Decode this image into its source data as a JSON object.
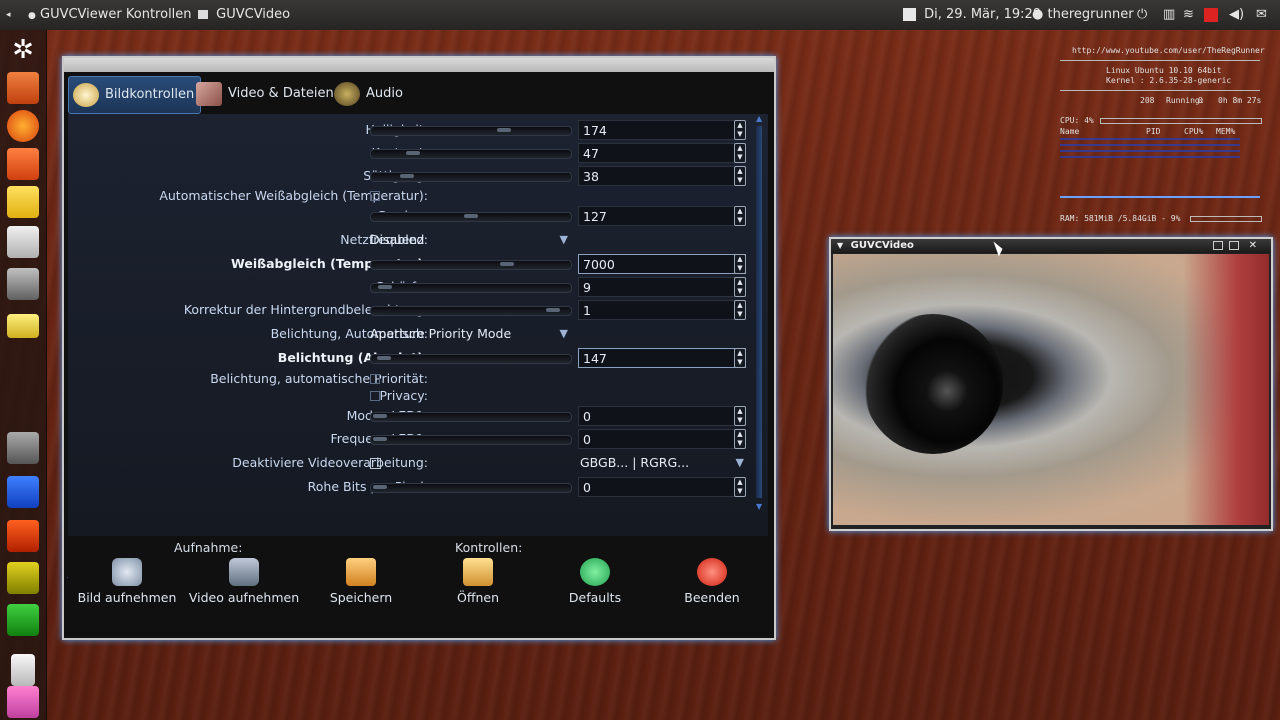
{
  "top_panel": {
    "app1": "GUVCViewer Kontrollen",
    "app2": "GUVCVideo",
    "clock": "Di, 29. Mär, 19:29",
    "user": "theregrunner"
  },
  "control_window": {
    "tabs": [
      {
        "label": "Bildkontrollen",
        "icon": "image-controls-icon"
      },
      {
        "label": "Video & Dateien",
        "icon": "video-files-icon"
      },
      {
        "label": "Audio",
        "icon": "audio-icon"
      }
    ],
    "controls": [
      {
        "label": "Helligkeit:",
        "type": "slider",
        "value": "174",
        "level": 0.68
      },
      {
        "label": "Kontrast:",
        "type": "slider",
        "value": "47",
        "level": 0.18
      },
      {
        "label": "Sättigung:",
        "type": "slider",
        "value": "38",
        "level": 0.15
      },
      {
        "label": "Automatischer Weißabgleich (Temperatur):",
        "type": "checkbox"
      },
      {
        "label": "Gewinn:",
        "type": "slider",
        "value": "127",
        "level": 0.5
      },
      {
        "label": "Netzfrequenz:",
        "type": "combo",
        "value": "Disabled"
      },
      {
        "label": "Weißabgleich (Temperatur):",
        "type": "slider",
        "value": "7000",
        "level": 0.7,
        "bold": true,
        "focus": true
      },
      {
        "label": "Schärfe:",
        "type": "slider",
        "value": "9",
        "level": 0.03
      },
      {
        "label": "Korrektur der Hintergrundbeleuchtung:",
        "type": "slider",
        "value": "1",
        "level": 0.95
      },
      {
        "label": "Belichtung, Automatisch:",
        "type": "combo",
        "value": "Aperture Priority Mode"
      },
      {
        "label": "Belichtung (Absolut):",
        "type": "slider",
        "value": "147",
        "level": 0.02,
        "bold": true,
        "focus": true
      },
      {
        "label": "Belichtung, automatische Priorität:",
        "type": "checkbox"
      },
      {
        "label": "Privacy:",
        "type": "checkbox"
      },
      {
        "label": "Modus LED1:",
        "type": "slider",
        "value": "0",
        "level": 0.0
      },
      {
        "label": "Frequenz LED1:",
        "type": "slider",
        "value": "0",
        "level": 0.0
      },
      {
        "label": "Deaktiviere Videoverarbeitung:",
        "type": "checkbox_combo",
        "value": "GBGB... | RGRG..."
      },
      {
        "label": "Rohe Bits pro Pixel:",
        "type": "slider",
        "value": "0",
        "level": 0.0
      }
    ],
    "sections": {
      "capture": "Aufnahme:",
      "controls": "Kontrollen:"
    },
    "buttons": [
      {
        "label": "Bild aufnehmen",
        "icon": "camera-photo-icon"
      },
      {
        "label": "Video aufnehmen",
        "icon": "video-camera-icon"
      },
      {
        "label": "Speichern",
        "icon": "folder-save-icon"
      },
      {
        "label": "Öffnen",
        "icon": "folder-open-icon"
      },
      {
        "label": "Defaults",
        "icon": "refresh-icon"
      },
      {
        "label": "Beenden",
        "icon": "close-icon"
      }
    ]
  },
  "video_window": {
    "title": "GUVCVideo"
  },
  "conky": {
    "url": "http://www.youtube.com/user/TheRegRunner",
    "os": "Linux Ubuntu 10.10 64bit",
    "kernel": "Kernel : 2.6.35-28-generic",
    "processes": "208",
    "running_label": "Running:",
    "running": "0",
    "uptime": "0h 8m 27s",
    "cpu": "CPU: 4%",
    "col_name": "Name",
    "col_pid": "PID",
    "col_cpu": "CPU%",
    "col_mem": "MEM%",
    "ram": "RAM: 581MiB /5.84GiB - 9%"
  }
}
